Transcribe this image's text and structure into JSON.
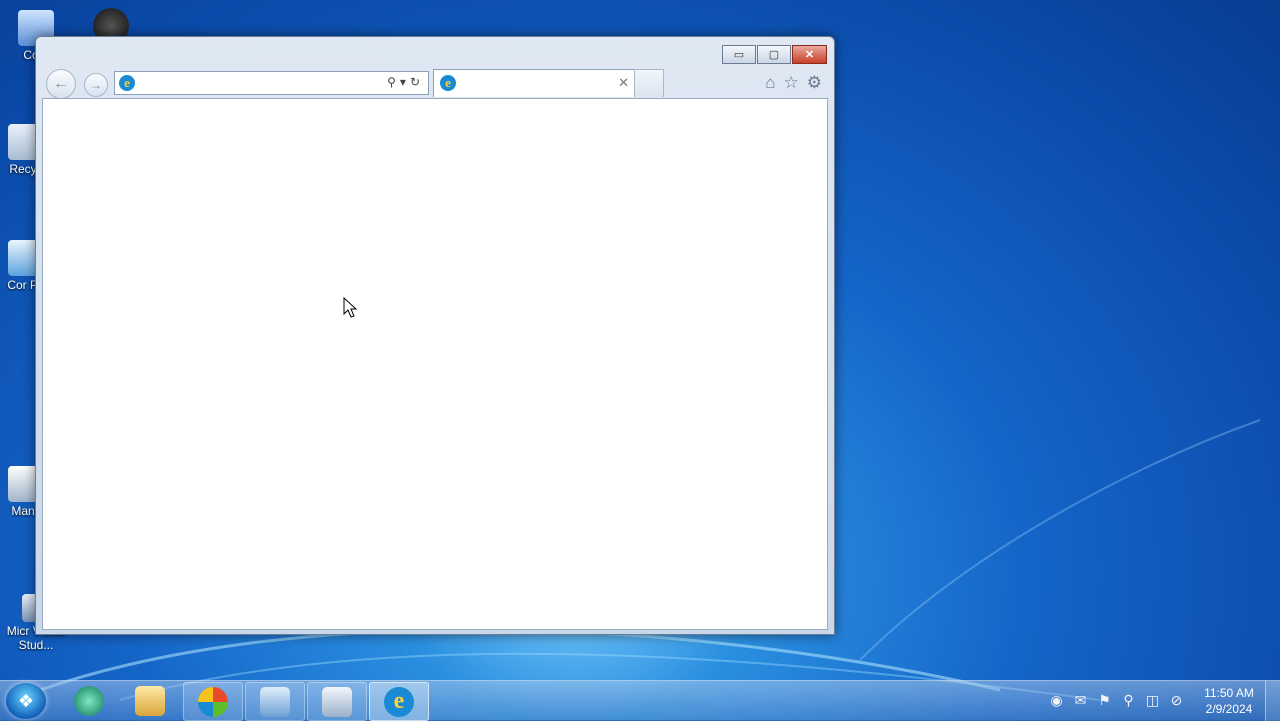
{
  "desktop": {
    "icons": [
      {
        "label": "Com"
      },
      {
        "label": ""
      },
      {
        "label": "Recyc"
      },
      {
        "label": "Cor Pa"
      },
      {
        "label": "Many"
      },
      {
        "label": "Micr Visual Stud..."
      }
    ]
  },
  "browser": {
    "address": {
      "value": "",
      "placeholder": ""
    },
    "tab": {
      "title": ""
    },
    "caption": {
      "minimize": "▭",
      "maximize": "▢",
      "close": "✕"
    }
  },
  "taskbar": {
    "items": [
      {
        "name": "start"
      },
      {
        "name": "app1"
      },
      {
        "name": "explorer"
      },
      {
        "name": "windows-media"
      },
      {
        "name": "remote-desktop"
      },
      {
        "name": "media-player"
      },
      {
        "name": "internet-explorer"
      }
    ],
    "clock": {
      "time": "11:50 AM",
      "date": "2/9/2024"
    }
  },
  "colors": {
    "accent": "#1a8ad4",
    "close_red": "#c7412a"
  }
}
